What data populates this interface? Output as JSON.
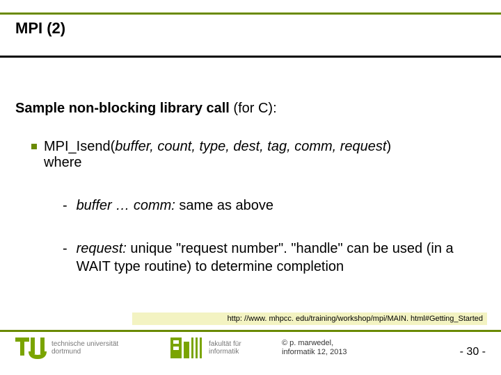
{
  "title": "MPI (2)",
  "subtitle_bold": "Sample non-blocking library call",
  "subtitle_rest": " (for C):",
  "bullet1_prefix": "MPI_Isend(",
  "bullet1_params": "buffer, count, type, dest, tag, comm, request",
  "bullet1_suffix": ")",
  "bullet1_line2": "where",
  "sub_a_italic": "buffer … comm:",
  "sub_a_rest": " same as above",
  "sub_b_italic": "request:",
  "sub_b_rest": " unique \"request number\". \"handle\" can be used (in a WAIT type routine) to determine completion",
  "url": "http: //www. mhpcc. edu/training/workshop/mpi/MAIN. html#Getting_Started",
  "uni_line1": "technische universität",
  "uni_line2": "dortmund",
  "fac_line1": "fakultät für",
  "fac_line2": "informatik",
  "copy_line1": "© p. marwedel,",
  "copy_line2": "informatik 12, 2013",
  "page_prefix": "- ",
  "page_num": "30",
  "page_suffix": " -",
  "dash": "-"
}
